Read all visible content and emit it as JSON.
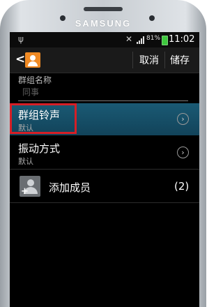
{
  "device": {
    "brand": "SAMSUNG"
  },
  "status_bar": {
    "battery": "81%",
    "time": "11:02"
  },
  "action_bar": {
    "back_icon": "chevron-left-icon",
    "app_icon": "contact-group-icon",
    "cancel_label": "取消",
    "save_label": "储存"
  },
  "group_name": {
    "label": "群组名称",
    "placeholder": "同事"
  },
  "settings": [
    {
      "title": "群组铃声",
      "subtitle": "默认",
      "icon": "chevron-right-icon"
    },
    {
      "title": "振动方式",
      "subtitle": "默认",
      "icon": "chevron-right-icon"
    }
  ],
  "add_member": {
    "label": "添加成员",
    "count": "(2)",
    "icon": "add-person-icon"
  },
  "colors": {
    "highlight_row": "#1a5a74",
    "annotation_border": "#d61f26",
    "app_icon": "#f08a24"
  }
}
